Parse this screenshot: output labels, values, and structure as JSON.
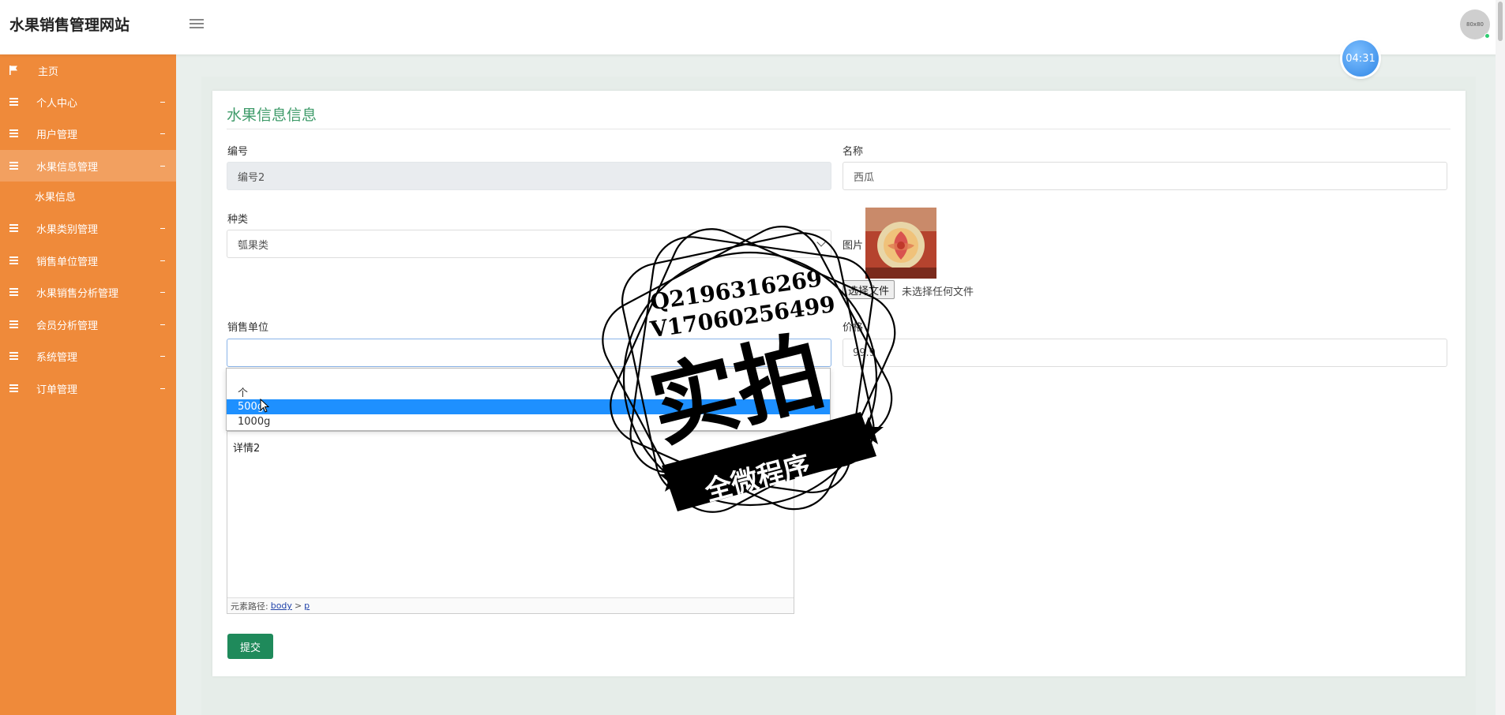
{
  "header": {
    "site_title": "水果销售管理网站",
    "avatar_text": "80x80"
  },
  "timer": "04:31",
  "sidebar": {
    "items": [
      {
        "label": "主页"
      },
      {
        "label": "个人中心"
      },
      {
        "label": "用户管理"
      },
      {
        "label": "水果信息管理"
      },
      {
        "label": "水果信息"
      },
      {
        "label": "水果类别管理"
      },
      {
        "label": "销售单位管理"
      },
      {
        "label": "水果销售分析管理"
      },
      {
        "label": "会员分析管理"
      },
      {
        "label": "系统管理"
      },
      {
        "label": "订单管理"
      }
    ]
  },
  "form": {
    "title": "水果信息信息",
    "number_label": "编号",
    "number_value": "编号2",
    "name_label": "名称",
    "name_value": "西瓜",
    "category_label": "种类",
    "category_value": "瓠果类",
    "image_label": "图片",
    "file_button": "选择文件",
    "file_status": "未选择任何文件",
    "unit_label": "销售单位",
    "unit_value": "",
    "price_label": "价格",
    "price_value": "99.9",
    "unit_options": [
      "",
      "个",
      "500g",
      "1000g"
    ],
    "selected_option_index": 2,
    "detail_text": "详情2",
    "editor_path_label": "元素路径:",
    "editor_path_body": "body",
    "editor_path_sep": ">",
    "editor_path_p": "p",
    "submit_label": "提交"
  },
  "watermark": {
    "line1": "Q2196316269",
    "line2": "V17060256499",
    "main": "实拍",
    "ribbon": "全微程序"
  },
  "colors": {
    "sidebar": "#ef8a3a",
    "sidebar_active": "#f2a060",
    "title_green": "#3f9b6a",
    "submit_green": "#1f8a5b",
    "option_selected": "#1e90ff"
  }
}
